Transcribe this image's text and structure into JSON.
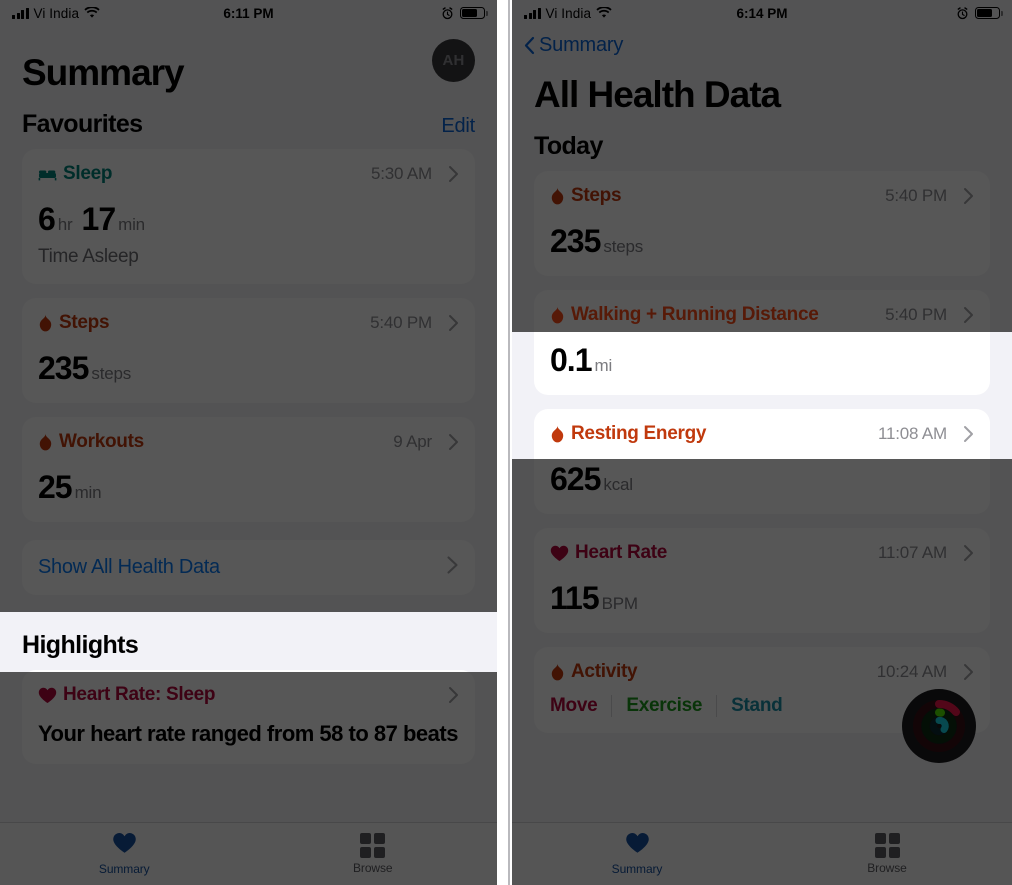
{
  "left_phone": {
    "status_bar": {
      "carrier": "Vi India",
      "time": "6:11 PM",
      "signal_icon": "cellular-bars-icon",
      "wifi_icon": "wifi-icon",
      "alarm_icon": "alarm-clock-icon",
      "battery_icon": "battery-icon"
    },
    "page_title": "Summary",
    "avatar_initials": "AH",
    "section": {
      "title": "Favourites",
      "action": "Edit"
    },
    "cards": [
      {
        "name": "Sleep",
        "icon": "bed-icon",
        "color": "#00857d",
        "time": "5:30 AM",
        "value": "6",
        "unit": "hr",
        "value2": "17",
        "unit2": "min",
        "subtitle": "Time Asleep"
      },
      {
        "name": "Steps",
        "icon": "flame-icon",
        "color": "#c0390d",
        "time": "5:40 PM",
        "value": "235",
        "unit": "steps"
      },
      {
        "name": "Workouts",
        "icon": "flame-icon",
        "color": "#c0390d",
        "time": "9 Apr",
        "value": "25",
        "unit": "min"
      }
    ],
    "show_all_link": "Show All Health Data",
    "highlights": {
      "title": "Highlights",
      "card": {
        "name": "Heart Rate: Sleep",
        "icon": "heart-icon",
        "color": "#b3063c",
        "body": "Your heart rate ranged from 58 to 87 beats"
      }
    },
    "tabs": [
      {
        "label": "Summary",
        "icon": "heart-icon",
        "active": true
      },
      {
        "label": "Browse",
        "icon": "grid-icon",
        "active": false
      }
    ]
  },
  "right_phone": {
    "status_bar": {
      "carrier": "Vi India",
      "time": "6:14 PM",
      "signal_icon": "cellular-bars-icon",
      "wifi_icon": "wifi-icon",
      "alarm_icon": "alarm-clock-icon",
      "battery_icon": "battery-icon"
    },
    "back_label": "Summary",
    "back_icon": "chevron-left-icon",
    "page_title": "All Health Data",
    "section_title": "Today",
    "cards": [
      {
        "name": "Steps",
        "icon": "flame-icon",
        "color": "#c0390d",
        "time": "5:40 PM",
        "value": "235",
        "unit": "steps"
      },
      {
        "name": "Walking + Running Distance",
        "icon": "flame-icon",
        "color": "#ff4d18",
        "time": "5:40 PM",
        "value": "0.1",
        "unit": "mi",
        "highlighted": true
      },
      {
        "name": "Resting Energy",
        "icon": "flame-icon",
        "color": "#c0390d",
        "time": "11:08 AM",
        "value": "625",
        "unit": "kcal"
      },
      {
        "name": "Heart Rate",
        "icon": "heart-icon",
        "color": "#b3063c",
        "time": "11:07 AM",
        "value": "115",
        "unit": "BPM"
      }
    ],
    "activity_card": {
      "name": "Activity",
      "icon": "flame-icon",
      "color": "#c0390d",
      "time": "10:24 AM",
      "columns": [
        {
          "label": "Move",
          "color": "#b3063c"
        },
        {
          "label": "Exercise",
          "color": "#1b9a1b"
        },
        {
          "label": "Stand",
          "color": "#1b8fa8"
        }
      ],
      "rings_icon": "activity-rings-icon"
    },
    "tabs": [
      {
        "label": "Summary",
        "icon": "heart-icon",
        "active": true
      },
      {
        "label": "Browse",
        "icon": "grid-icon",
        "active": false
      }
    ]
  },
  "colors": {
    "accent_blue": "#0b7bf7",
    "highlight_backing": "#f2f2f7",
    "page_background": "#f2f2f7",
    "dim_overlay": "rgba(0,0,0,0.66)"
  }
}
